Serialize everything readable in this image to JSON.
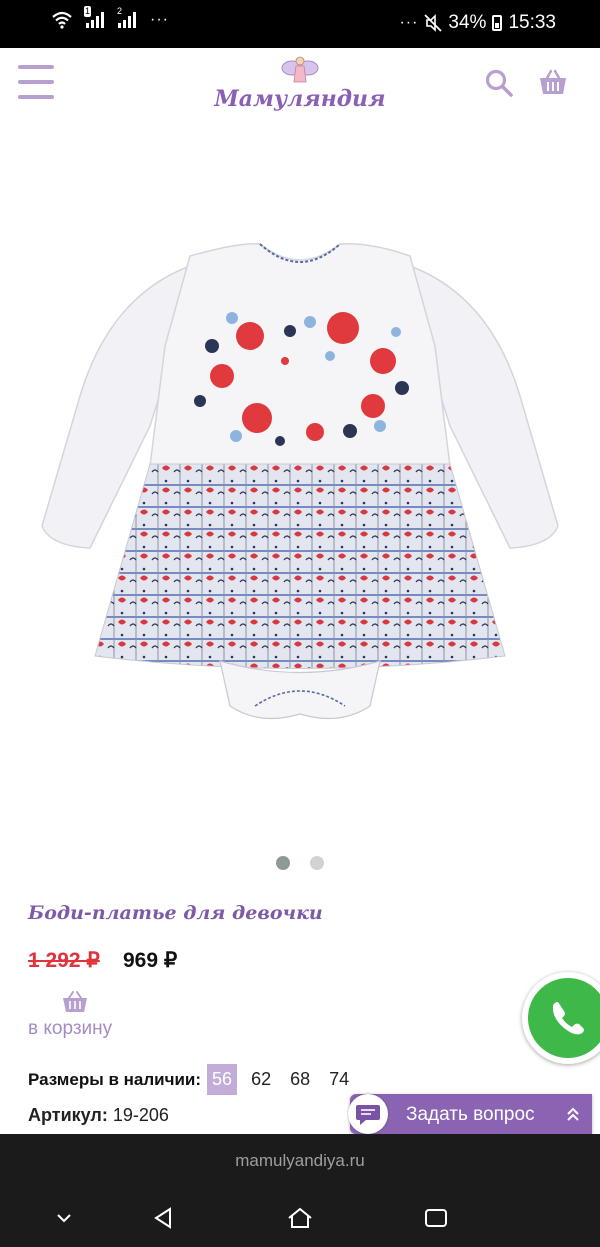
{
  "status_bar": {
    "sim1_badge": "1",
    "sim2_badge": "2",
    "overflow": "···",
    "more": "···",
    "battery": "34%",
    "time": "15:33"
  },
  "header": {
    "logo_text": "Мамуляндия"
  },
  "gallery": {
    "slide_count": 2,
    "active_slide": 1
  },
  "product": {
    "title": "Боди-платье для девочки",
    "old_price": "1 292 ₽",
    "new_price": "969 ₽",
    "to_cart_label": "в корзину",
    "sizes_label": "Размеры в наличии:",
    "sizes": [
      "56",
      "62",
      "68",
      "74"
    ],
    "selected_size": "56",
    "article_label": "Артикул:",
    "article_value": "19-206"
  },
  "ask_widget": {
    "label": "Задать вопрос"
  },
  "browser": {
    "url": "mamulyandiya.ru"
  },
  "colors": {
    "brand_purple": "#8a5fb5",
    "accent_lilac": "#b79fd0",
    "old_price_red": "#e0343a",
    "call_green": "#3fb84a"
  }
}
